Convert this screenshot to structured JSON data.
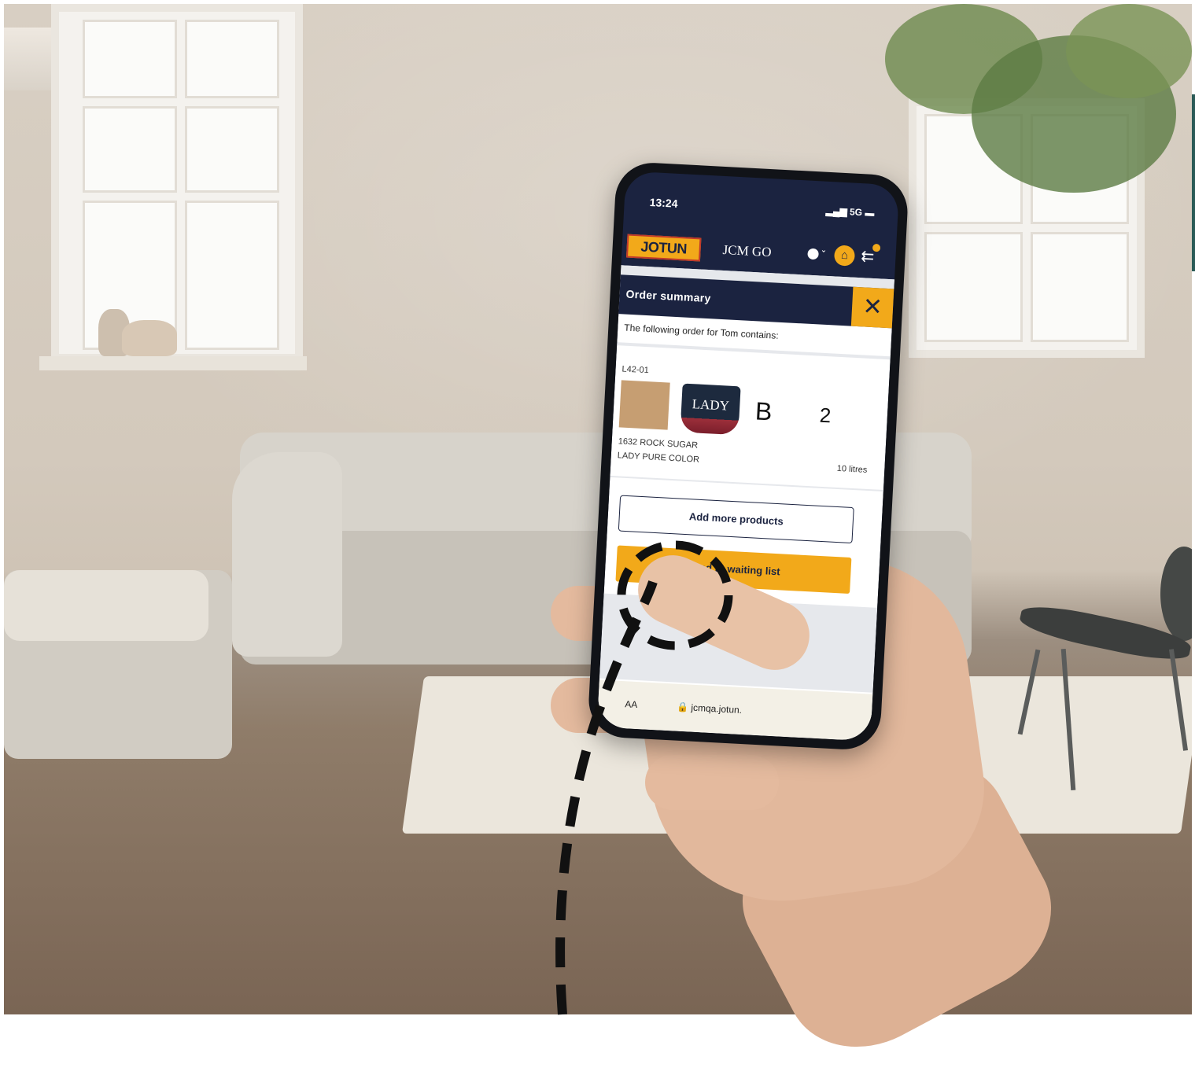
{
  "phone": {
    "status": {
      "time": "13:24",
      "signal": "5G"
    },
    "app": {
      "logo_text": "JOTUN",
      "title": "JCM GO",
      "icons": [
        "user-icon",
        "chevron-down-icon",
        "home-icon",
        "menu-icon"
      ]
    },
    "order_summary": {
      "title": "Order summary",
      "close_icon": "✕",
      "intro": "The following order for Tom contains:",
      "items": [
        {
          "code": "L42-01",
          "swatch_color": "#c69e72",
          "product_label": "LADY",
          "base": "B",
          "quantity": "2",
          "color_name": "1632 ROCK SUGAR",
          "product_name": "LADY PURE COLOR",
          "volume": "10 litres"
        }
      ],
      "add_more_label": "Add more products",
      "send_label": "Send to waiting list"
    },
    "browser": {
      "aa": "AA",
      "url": "jcmqa.jotun."
    }
  },
  "colors": {
    "navy": "#1b2340",
    "accent": "#f2a91a"
  }
}
